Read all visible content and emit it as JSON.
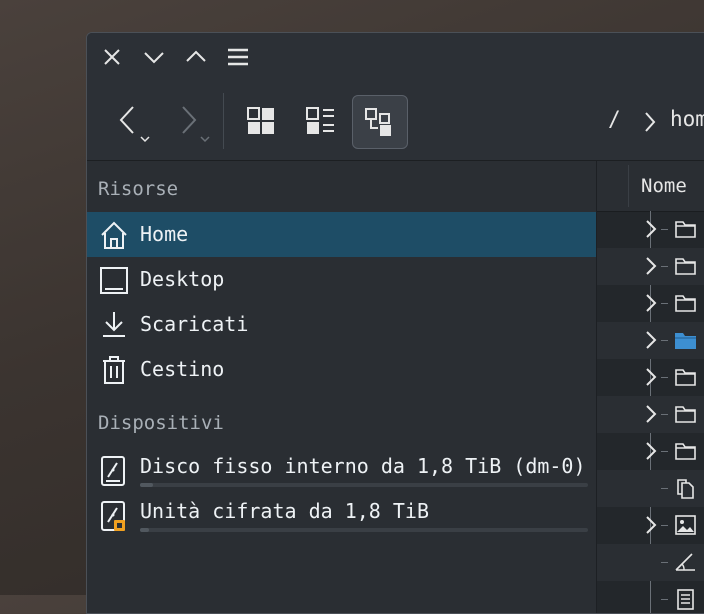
{
  "window": {
    "controls": [
      "close",
      "minimize",
      "maximize",
      "menu"
    ]
  },
  "toolbar": {
    "back_label": "",
    "forward_label": "",
    "views": [
      "icons",
      "compact",
      "details"
    ],
    "active_view": "details",
    "breadcrumb": [
      "/",
      "hom"
    ]
  },
  "sidebar": {
    "places_title": "Risorse",
    "places": [
      {
        "label": "Home",
        "icon": "home-icon",
        "active": true
      },
      {
        "label": "Desktop",
        "icon": "desktop-icon",
        "active": false
      },
      {
        "label": "Scaricati",
        "icon": "download-icon",
        "active": false
      },
      {
        "label": "Cestino",
        "icon": "trash-icon",
        "active": false
      }
    ],
    "devices_title": "Dispositivi",
    "devices": [
      {
        "label": "Disco fisso interno da 1,8 TiB (dm-0)",
        "icon": "harddisk-icon",
        "usage": 0.03
      },
      {
        "label": "Unità cifrata da 1,8 TiB",
        "icon": "encrypted-drive-icon",
        "usage": 0.02
      }
    ]
  },
  "content": {
    "column_header": "Nome",
    "rows": [
      {
        "expander": true,
        "type": "folder"
      },
      {
        "expander": true,
        "type": "folder"
      },
      {
        "expander": true,
        "type": "folder"
      },
      {
        "expander": true,
        "type": "folder-blue"
      },
      {
        "expander": true,
        "type": "folder"
      },
      {
        "expander": true,
        "type": "folder"
      },
      {
        "expander": true,
        "type": "folder"
      },
      {
        "expander": false,
        "type": "file-copy"
      },
      {
        "expander": true,
        "type": "image"
      },
      {
        "expander": false,
        "type": "drawing"
      },
      {
        "expander": false,
        "type": "document"
      }
    ]
  },
  "colors": {
    "accent": "#1e4d66",
    "background": "#2a2e33",
    "text": "#eef2f5",
    "folder_blue": "#3d8fd1"
  }
}
